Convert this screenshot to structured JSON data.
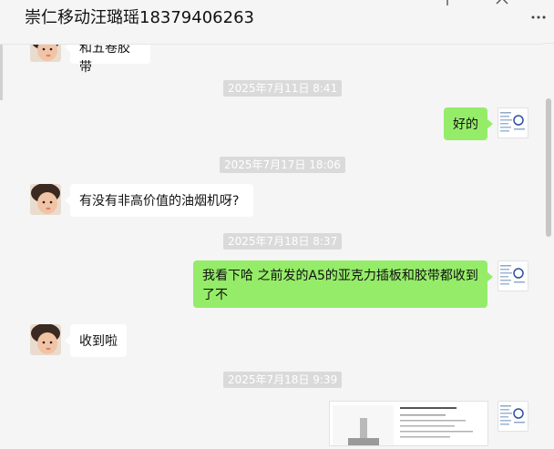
{
  "chat": {
    "title": "崇仁移动汪璐瑶18379406263"
  },
  "messages": [
    {
      "type": "incoming",
      "text": "和五卷胶带"
    },
    {
      "type": "time",
      "text": "2025年7月11日 8:41"
    },
    {
      "type": "outgoing",
      "text": "好的"
    },
    {
      "type": "time",
      "text": "2025年7月17日 18:06"
    },
    {
      "type": "incoming",
      "text": "有没有非高价值的油烟机呀?"
    },
    {
      "type": "time",
      "text": "2025年7月18日 8:37"
    },
    {
      "type": "outgoing",
      "text": "我看下哈 之前发的A5的亚克力插板和胶带都收到了不"
    },
    {
      "type": "incoming",
      "text": "收到啦"
    },
    {
      "type": "time",
      "text": "2025年7月18日 9:39"
    },
    {
      "type": "outgoing-image",
      "text": ""
    }
  ],
  "icons": {
    "add": "plus-icon",
    "close": "close-icon",
    "more": "more-horizontal-icon"
  },
  "colors": {
    "outgoing_bubble": "#95ec69",
    "incoming_bubble": "#ffffff",
    "background": "#f5f5f5",
    "timestamp_bg": "#dadada"
  }
}
